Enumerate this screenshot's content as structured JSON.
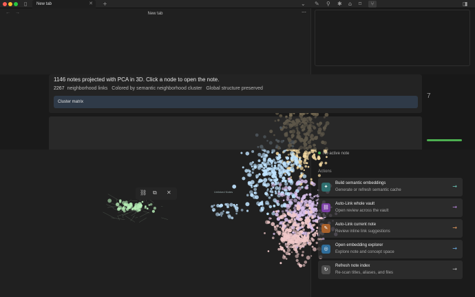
{
  "tab": {
    "title": "New tab"
  },
  "nav": {
    "title": "New tab"
  },
  "overlay": {
    "headline": "1146 notes projected with PCA in 3D. Click a node to open the note.",
    "links_count": "2267",
    "links_label": "neighborhood links",
    "colored_by": "Colored by semantic neighborhood cluster",
    "global": "Global structure preserved",
    "cluster_button": "Cluster matrix"
  },
  "side": {
    "big_number": "7",
    "active_note": "No active note",
    "actions_heading": "Actions"
  },
  "actions": [
    {
      "title": "Build semantic embeddings",
      "subtitle": "Generate or refresh semantic cache",
      "icon": "sparkle-icon",
      "color": "#2f6f6f",
      "arrow": "#6fd0c0"
    },
    {
      "title": "Auto-Link whole vault",
      "subtitle": "Open review across the vault",
      "icon": "link-icon",
      "color": "#7b3fa6",
      "arrow": "#c08ae8"
    },
    {
      "title": "Auto-Link current note",
      "subtitle": "Review inline link suggestions",
      "icon": "note-link-icon",
      "color": "#a8612b",
      "arrow": "#f0a060"
    },
    {
      "title": "Open embedding explorer",
      "subtitle": "Explore note and concept space",
      "icon": "compass-icon",
      "color": "#2f6d9a",
      "arrow": "#6fb5f0"
    },
    {
      "title": "Refresh note index",
      "subtitle": "Re-scan titles, aliases, and files",
      "icon": "refresh-icon",
      "color": "#505050",
      "arrow": "#b8b8b8"
    }
  ],
  "graph": {
    "label": "Unlinked Notes"
  },
  "colors": {
    "accent": "#4caf50",
    "green_cluster": "#b8f0b8",
    "blue_cluster": "#bfe3ff",
    "yellow_cluster": "#f2d7a0",
    "purple_cluster": "#d9c0ec",
    "pink_cluster": "#f0c8c8"
  }
}
